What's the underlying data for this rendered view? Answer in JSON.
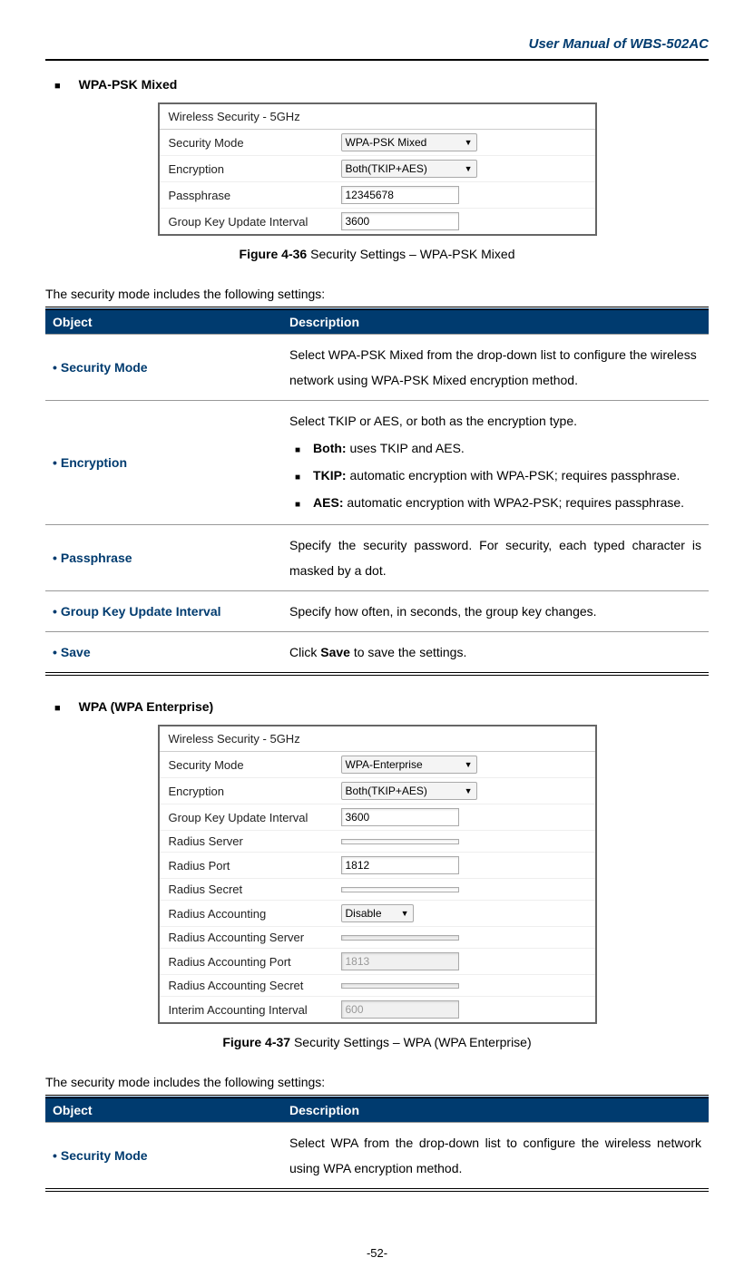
{
  "header": {
    "title": "User Manual of WBS-502AC"
  },
  "section1": {
    "heading": "WPA-PSK Mixed",
    "figure": {
      "title": "Wireless Security - 5GHz",
      "rows": [
        {
          "label": "Security Mode",
          "type": "select",
          "value": "WPA-PSK Mixed"
        },
        {
          "label": "Encryption",
          "type": "select",
          "value": "Both(TKIP+AES)"
        },
        {
          "label": "Passphrase",
          "type": "input",
          "value": "12345678"
        },
        {
          "label": "Group Key Update Interval",
          "type": "input",
          "value": "3600"
        }
      ]
    },
    "caption_bold": "Figure 4-36",
    "caption_rest": " Security Settings – WPA-PSK Mixed",
    "intro": "The security mode includes the following settings:",
    "table": {
      "h1": "Object",
      "h2": "Description",
      "rows": {
        "r1_obj": "Security Mode",
        "r1_desc": "Select WPA-PSK Mixed from the drop-down list to configure the wireless network using WPA-PSK Mixed encryption method.",
        "r2_obj": "Encryption",
        "r2_line": "Select TKIP or AES, or both as the encryption type.",
        "r2_b1_b": "Both:",
        "r2_b1_r": " uses TKIP and AES.",
        "r2_b2_b": "TKIP:",
        "r2_b2_r": " automatic encryption with WPA-PSK; requires passphrase.",
        "r2_b3_b": "AES:",
        "r2_b3_r": " automatic encryption with WPA2-PSK; requires passphrase.",
        "r3_obj": "Passphrase",
        "r3_desc": "Specify the security password. For security, each typed character is masked by a dot.",
        "r4_obj": "Group Key Update Interval",
        "r4_desc": "Specify how often, in seconds, the group key changes.",
        "r5_obj": "Save",
        "r5_pre": "Click ",
        "r5_b": "Save",
        "r5_post": " to save the settings."
      }
    }
  },
  "section2": {
    "heading": "WPA (WPA Enterprise)",
    "figure": {
      "title": "Wireless Security - 5GHz",
      "rows": [
        {
          "label": "Security Mode",
          "type": "select",
          "value": "WPA-Enterprise"
        },
        {
          "label": "Encryption",
          "type": "select",
          "value": "Both(TKIP+AES)"
        },
        {
          "label": "Group Key Update Interval",
          "type": "input",
          "value": "3600"
        },
        {
          "label": "Radius Server",
          "type": "input",
          "value": ""
        },
        {
          "label": "Radius Port",
          "type": "input",
          "value": "1812"
        },
        {
          "label": "Radius Secret",
          "type": "input",
          "value": ""
        },
        {
          "label": "Radius Accounting",
          "type": "select-small",
          "value": "Disable"
        },
        {
          "label": "Radius Accounting Server",
          "type": "input-disabled",
          "value": ""
        },
        {
          "label": "Radius Accounting Port",
          "type": "input-disabled",
          "value": "1813"
        },
        {
          "label": "Radius Accounting Secret",
          "type": "input-disabled",
          "value": ""
        },
        {
          "label": "Interim Accounting Interval",
          "type": "input-disabled",
          "value": "600"
        }
      ]
    },
    "caption_bold": "Figure 4-37",
    "caption_rest": " Security Settings – WPA (WPA Enterprise)",
    "intro": "The security mode includes the following settings:",
    "table": {
      "h1": "Object",
      "h2": "Description",
      "rows": {
        "r1_obj": "Security Mode",
        "r1_desc": "Select WPA from the drop-down list to configure the wireless network using WPA encryption method."
      }
    }
  },
  "pagenum": "-52-"
}
